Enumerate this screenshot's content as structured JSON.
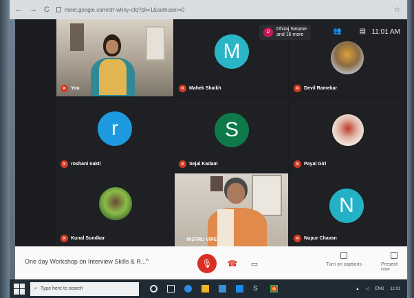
{
  "browser": {
    "back": "←",
    "forward": "→",
    "reload": "C",
    "url": "meet.google.com/cfr-whny-cfq?pli=1&authuser=0",
    "right_icons": [
      "☆"
    ]
  },
  "meet": {
    "people_chip": {
      "initial": "D",
      "line1": "Dhiraj Sasane",
      "line2": "and 16 more"
    },
    "clock": "11:01 AM",
    "tiles": [
      {
        "name": "You"
      },
      {
        "name": "Mahek Shaikh",
        "initial": "M",
        "color": "#2bb6c8"
      },
      {
        "name": "Devil Ramekar"
      },
      {
        "name": "roshani nakti",
        "initial": "r",
        "color": "#1e9be0"
      },
      {
        "name": "Sejal Kadam",
        "initial": "S",
        "color": "#0e7a4a"
      },
      {
        "name": "Payal Giri"
      },
      {
        "name": "Kunal Sondkar"
      },
      {
        "name": "INSTRU VIPE"
      },
      {
        "name": "Nupur Chavan",
        "initial": "N",
        "color": "#24b1c6"
      }
    ]
  },
  "controls": {
    "meeting_title": "One day Workshop on Interview Skills & R...",
    "chevron": "^",
    "captions_label": "Turn on captions",
    "present_label": "Present now"
  },
  "taskbar": {
    "search_placeholder": "Type here to search",
    "tray_lang": "ENG",
    "tray_time": "11:01"
  },
  "colors": {
    "mic_off": "#d33b22",
    "hangup": "#d93025"
  }
}
